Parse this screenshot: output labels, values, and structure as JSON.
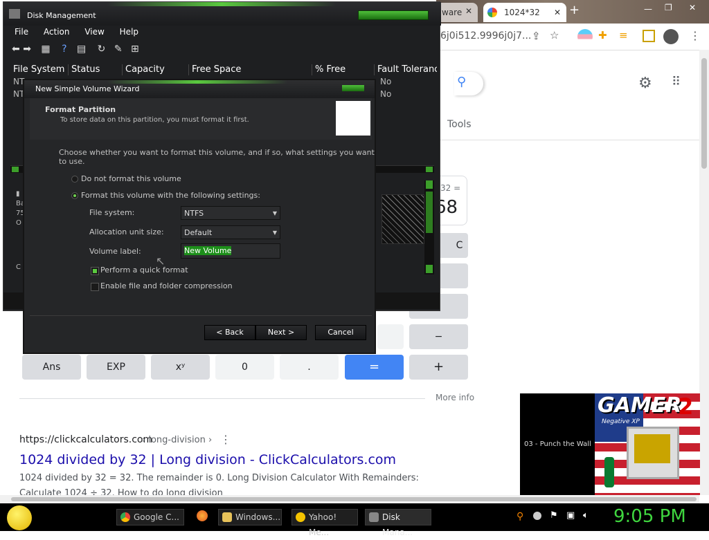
{
  "chrome": {
    "tabs": [
      {
        "label": "ware"
      },
      {
        "label": "1024*32"
      }
    ],
    "new_tab": "+",
    "address_fragment": "6j0i512.9996j0j7...",
    "toolbar_tools_label": "Tools",
    "calculator": {
      "result_partial": "68",
      "expression_partial": "32 =",
      "buttons_row_last": [
        "Ans",
        "EXP",
        "xʸ",
        "0",
        ".",
        "=",
        "+"
      ],
      "minus": "−",
      "c_partial": "C"
    },
    "more_info": "More info",
    "result": {
      "url": "https://clickcalculators.com",
      "breadcrumb": "› long-division ›",
      "title": "1024 divided by 32 | Long division - ClickCalculators.com",
      "snippet": "1024 divided by 32 = 32. The remainder is 0. Long Division Calculator With Remainders:",
      "snippet2": "Calculate 1024 ÷ 32. How to do long division"
    },
    "media": {
      "track": "03 - Punch the Wall",
      "logo_text": "GAMER",
      "logo_number": "2",
      "logo_sub": "Negative XP"
    }
  },
  "disk": {
    "title": "Disk Management",
    "menu": [
      "File",
      "Action",
      "View",
      "Help"
    ],
    "columns": [
      "File System",
      "Status",
      "Capacity",
      "Free Space",
      "% Free",
      "Fault Toleranc"
    ],
    "rows": [
      {
        "fs": "NT",
        "fault": "No"
      },
      {
        "fs": "NT",
        "fault": "No"
      }
    ],
    "disk_labels": [
      "Ba",
      "75",
      "O",
      "C"
    ]
  },
  "wizard": {
    "title": "New Simple Volume Wizard",
    "heading": "Format Partition",
    "subheading": "To store data on this partition, you must format it first.",
    "intro": "Choose whether you want to format this volume, and if so, what settings you want to use.",
    "radio_no_format": "Do not format this volume",
    "radio_format": "Format this volume with the following settings:",
    "file_system_label": "File system:",
    "file_system_value": "NTFS",
    "alloc_label": "Allocation unit size:",
    "alloc_value": "Default",
    "volume_label_label": "Volume label:",
    "volume_label_value": "New Volume",
    "quick_format": "Perform a quick format",
    "compression": "Enable file and folder compression",
    "back": "< Back",
    "next": "Next >",
    "cancel": "Cancel"
  },
  "taskbar": {
    "items": [
      "Google C...",
      "Windows...",
      "Yahoo! Me...",
      "Disk Mana..."
    ],
    "clock": "9:05 PM"
  }
}
